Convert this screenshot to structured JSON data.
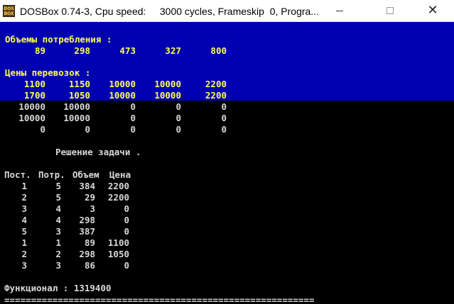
{
  "window": {
    "title": "DOSBox 0.74-3, Cpu speed:     3000 cycles, Frameskip  0, Progra...",
    "icon_text_top": "DOS",
    "icon_text_bottom": "BOX",
    "minimize_icon": "minimize-icon",
    "maximize_icon": "maximize-icon",
    "close_icon": "close-icon",
    "close_glyph": "✕"
  },
  "colors": {
    "blue_band": "#0000b0",
    "yellow_text": "#ffff55",
    "white_text": "#d8d8d8",
    "background": "#000000"
  },
  "console": {
    "consumption_label": "Объемы потребления :",
    "consumption_values": [
      "89",
      "298",
      "473",
      "327",
      "800"
    ],
    "prices_label": "Цены перевозок :",
    "price_matrix": [
      [
        "1100",
        "1150",
        "10000",
        "10000",
        "2200"
      ],
      [
        "1700",
        "1050",
        "10000",
        "10000",
        "2200"
      ],
      [
        "10000",
        "10000",
        "0",
        "0",
        "0"
      ],
      [
        "10000",
        "10000",
        "0",
        "0",
        "0"
      ],
      [
        "0",
        "0",
        "0",
        "0",
        "0"
      ]
    ],
    "solution_label": "Решение задачи .",
    "solution_headers": [
      "Пост.",
      "Потр.",
      "Объем",
      "Цена"
    ],
    "solution_rows": [
      [
        "1",
        "5",
        "384",
        "2200"
      ],
      [
        "2",
        "5",
        "29",
        "2200"
      ],
      [
        "3",
        "4",
        "3",
        "0"
      ],
      [
        "4",
        "4",
        "298",
        "0"
      ],
      [
        "5",
        "3",
        "387",
        "0"
      ],
      [
        "1",
        "1",
        "89",
        "1100"
      ],
      [
        "2",
        "2",
        "298",
        "1050"
      ],
      [
        "3",
        "3",
        "86",
        "0"
      ]
    ],
    "functional_label": "Функционал : 1319400",
    "separator": "=========================================================="
  }
}
